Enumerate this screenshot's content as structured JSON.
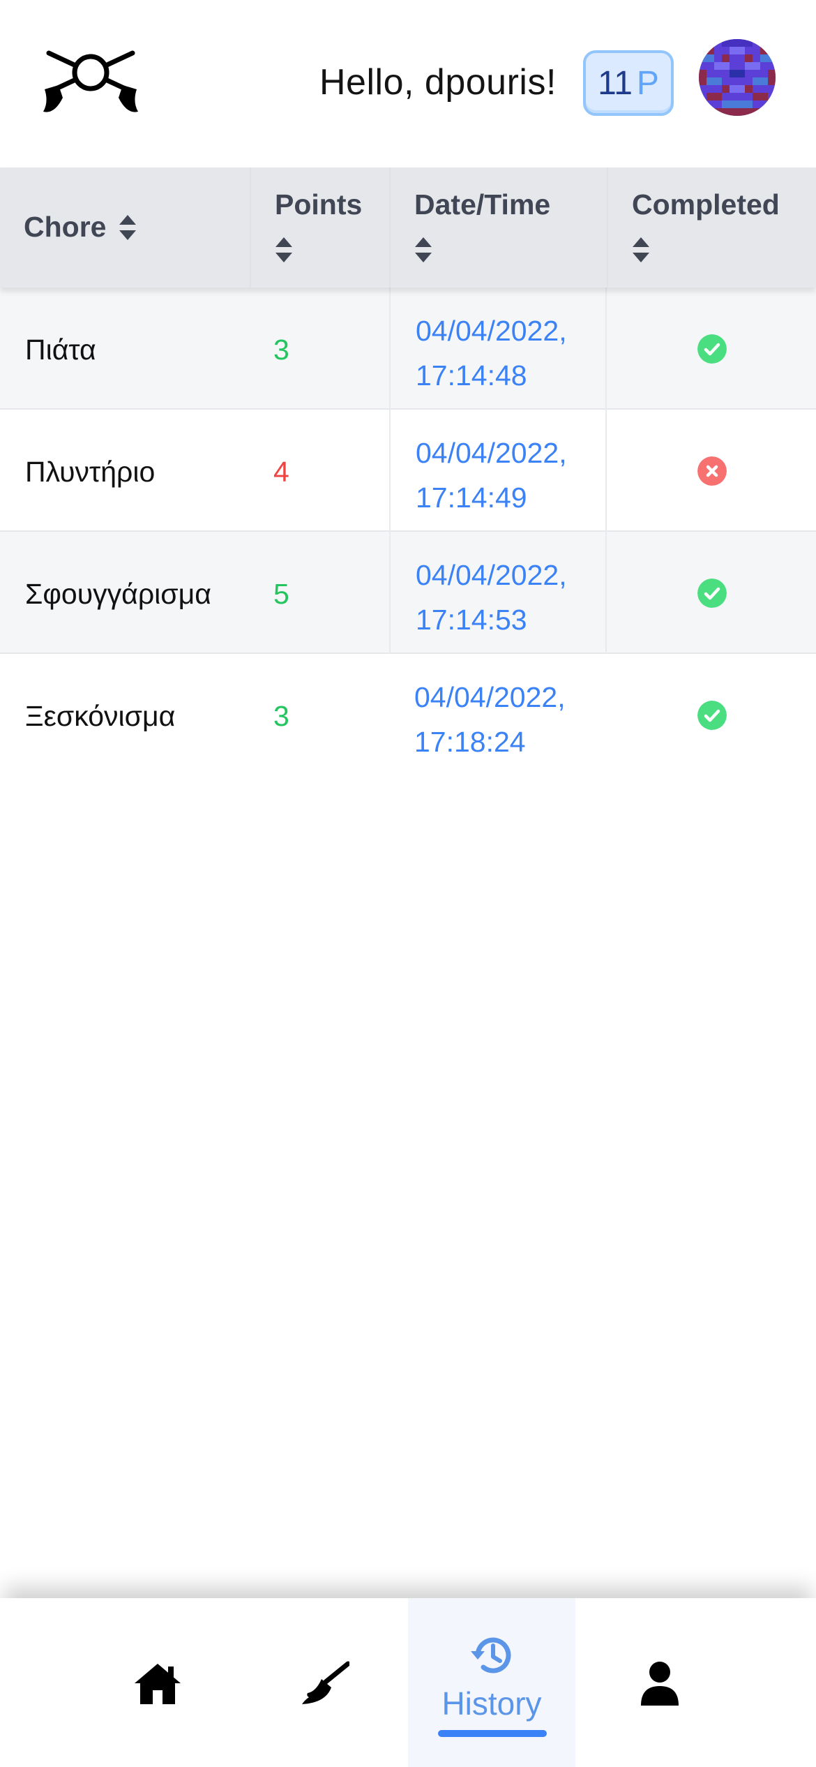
{
  "header": {
    "greeting": "Hello, dpouris!",
    "points_value": "11",
    "points_unit": "P",
    "logo_icon": "crossed-brooms-icon",
    "avatar_icon": "pixel-avatar"
  },
  "table": {
    "columns": [
      "Chore",
      "Points",
      "Date/Time",
      "Completed"
    ],
    "rows": [
      {
        "chore": "Πιάτα",
        "points": "3",
        "date": "04/04/2022,",
        "time": "17:14:48",
        "completed": true
      },
      {
        "chore": "Πλυντήριο",
        "points": "4",
        "date": "04/04/2022,",
        "time": "17:14:49",
        "completed": false
      },
      {
        "chore": "Σφουγγάρισμα",
        "points": "5",
        "date": "04/04/2022,",
        "time": "17:14:53",
        "completed": true
      },
      {
        "chore": "Ξεσκόνισμα",
        "points": "3",
        "date": "04/04/2022,",
        "time": "17:18:24",
        "completed": true
      }
    ]
  },
  "nav": {
    "items": [
      {
        "icon": "home-icon",
        "label": ""
      },
      {
        "icon": "broom-icon",
        "label": ""
      },
      {
        "icon": "history-icon",
        "label": "History",
        "active": true
      },
      {
        "icon": "user-icon",
        "label": ""
      }
    ]
  },
  "colors": {
    "accent": "#3b82f6",
    "success": "#4ade80",
    "danger": "#f87171",
    "points_positive": "#22c55e",
    "points_negative": "#ef4444",
    "header_bg": "#e5e7eb"
  }
}
